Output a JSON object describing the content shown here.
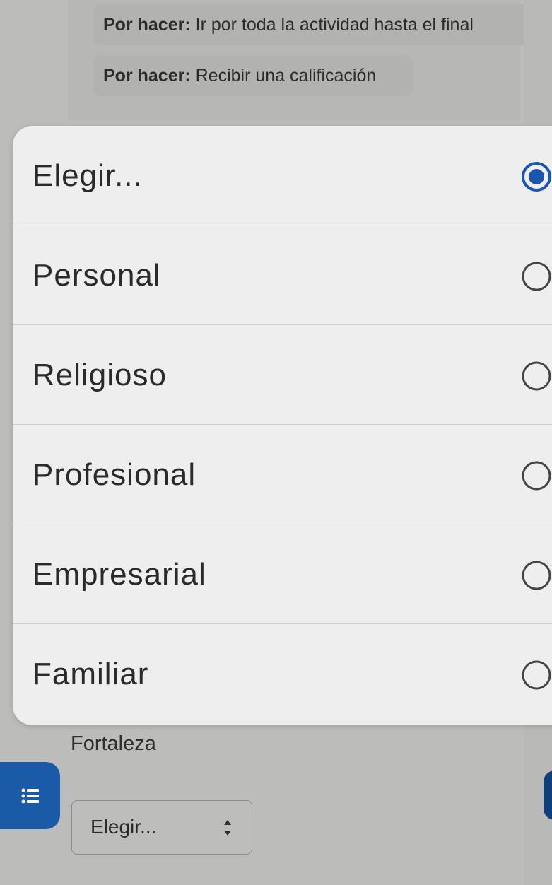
{
  "background": {
    "todos": [
      {
        "prefix": "Por hacer:",
        "text": " Ir por toda la actividad hasta el final"
      },
      {
        "prefix": "Por hacer:",
        "text": " Recibir una calificación"
      }
    ],
    "field_label": "Fortaleza",
    "select": {
      "value": "Elegir..."
    }
  },
  "dialog": {
    "options": [
      {
        "label": "Elegir...",
        "selected": true
      },
      {
        "label": "Personal",
        "selected": false
      },
      {
        "label": "Religioso",
        "selected": false
      },
      {
        "label": "Profesional",
        "selected": false
      },
      {
        "label": "Empresarial",
        "selected": false
      },
      {
        "label": "Familiar",
        "selected": false
      }
    ]
  },
  "colors": {
    "accent": "#1b5aa7",
    "radio_selected": "#1a56b0",
    "radio_unselected": "#444444"
  },
  "icons": {
    "fab": "list-icon",
    "select_arrows": "sort-arrows-icon"
  }
}
